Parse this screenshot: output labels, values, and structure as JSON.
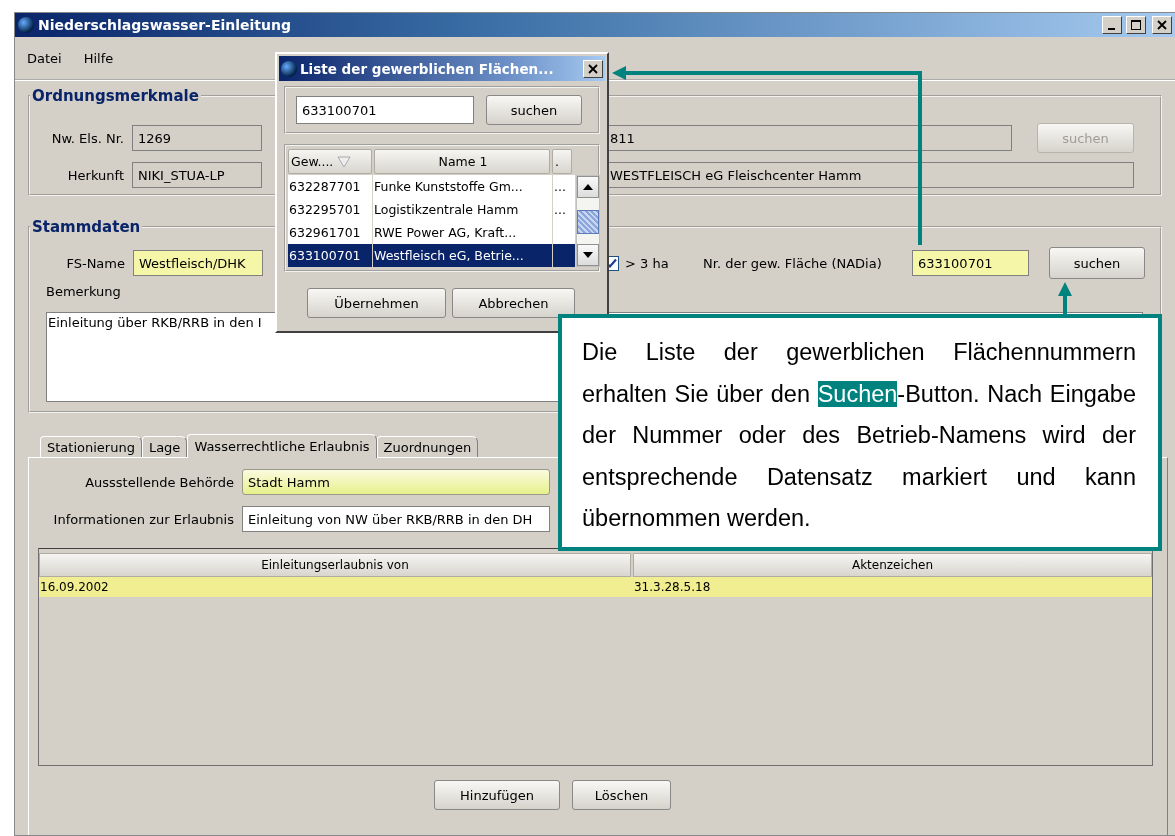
{
  "window": {
    "title": "Niederschlagswasser-Einleitung"
  },
  "menu": [
    "Datei",
    "Hilfe"
  ],
  "ordnungsmerkmale": {
    "legend": "Ordnungsmerkmale",
    "nw_els_nr_label": "Nw. Els. Nr.",
    "nw_els_nr": "1269",
    "herkunft_label": "Herkunft",
    "herkunft": "NIKI_STUA-LP",
    "field_3": "811",
    "field_4": "WESTFLEISCH eG Fleischcenter Hamm",
    "search_button": {
      "label": "suchen",
      "disabled": true
    }
  },
  "stammdaten": {
    "legend": "Stammdaten",
    "fs_name_label": "FS-Name",
    "fs_name": "Westfleisch/DHK",
    "over_3ha": {
      "label": "> 3 ha",
      "checked": true
    },
    "nadia_label": "Nr. der gew. Fläche (NADia)",
    "nadia": "633100701",
    "search_button": {
      "label": "suchen",
      "disabled": false
    },
    "bemerkung_label": "Bemerkung",
    "bemerkung": "Einleitung über RKB/RRB in den I"
  },
  "tabs": [
    {
      "label": "Stationierung",
      "selected": false
    },
    {
      "label": "Lage",
      "selected": false
    },
    {
      "label": "Wasserrechtliche Erlaubnis",
      "selected": true
    },
    {
      "label": "Zuordnungen",
      "selected": false
    }
  ],
  "erlaubnis": {
    "behoerde_label": "Aussstellende Behörde",
    "behoerde": "Stadt Hamm",
    "info_label": "Informationen zur Erlaubnis",
    "info": "Einleitung von NW über RKB/RRB in den DH",
    "table": {
      "columns": [
        "Einleitungserlaubnis von",
        "Aktenzeichen"
      ],
      "rows": [
        {
          "cells": [
            "16.09.2002",
            "31.3.28.5.18"
          ],
          "selected": true
        }
      ]
    },
    "buttons": [
      "Hinzufügen",
      "Löschen"
    ]
  },
  "dialog": {
    "title": "Liste der gewerblichen Flächen...",
    "search": "633100701",
    "search_button": "suchen",
    "columns": [
      "Gew....",
      "Name 1",
      "."
    ],
    "rows": [
      {
        "cells": [
          "632287701",
          "Funke Kunststoffe Gm...",
          "..."
        ],
        "selected": false
      },
      {
        "cells": [
          "632295701",
          "Logistikzentrale Hamm",
          "..."
        ],
        "selected": false
      },
      {
        "cells": [
          "632961701",
          "RWE Power AG, Kraft...",
          ""
        ],
        "selected": false
      },
      {
        "cells": [
          "633100701",
          "Westfleisch eG, Betrie...",
          ""
        ],
        "selected": true
      }
    ],
    "buttons": [
      "Übernehmen",
      "Abbrechen"
    ]
  },
  "callout": {
    "before": "Die Liste der gewerblichen Flächennummern erhalten Sie über den ",
    "highlight": "Suchen",
    "after": "-Button. Nach Eingabe der Nummer oder des Betrieb-Namens wird der entsprechende Datensatz markiert und kann übernommen werden."
  }
}
